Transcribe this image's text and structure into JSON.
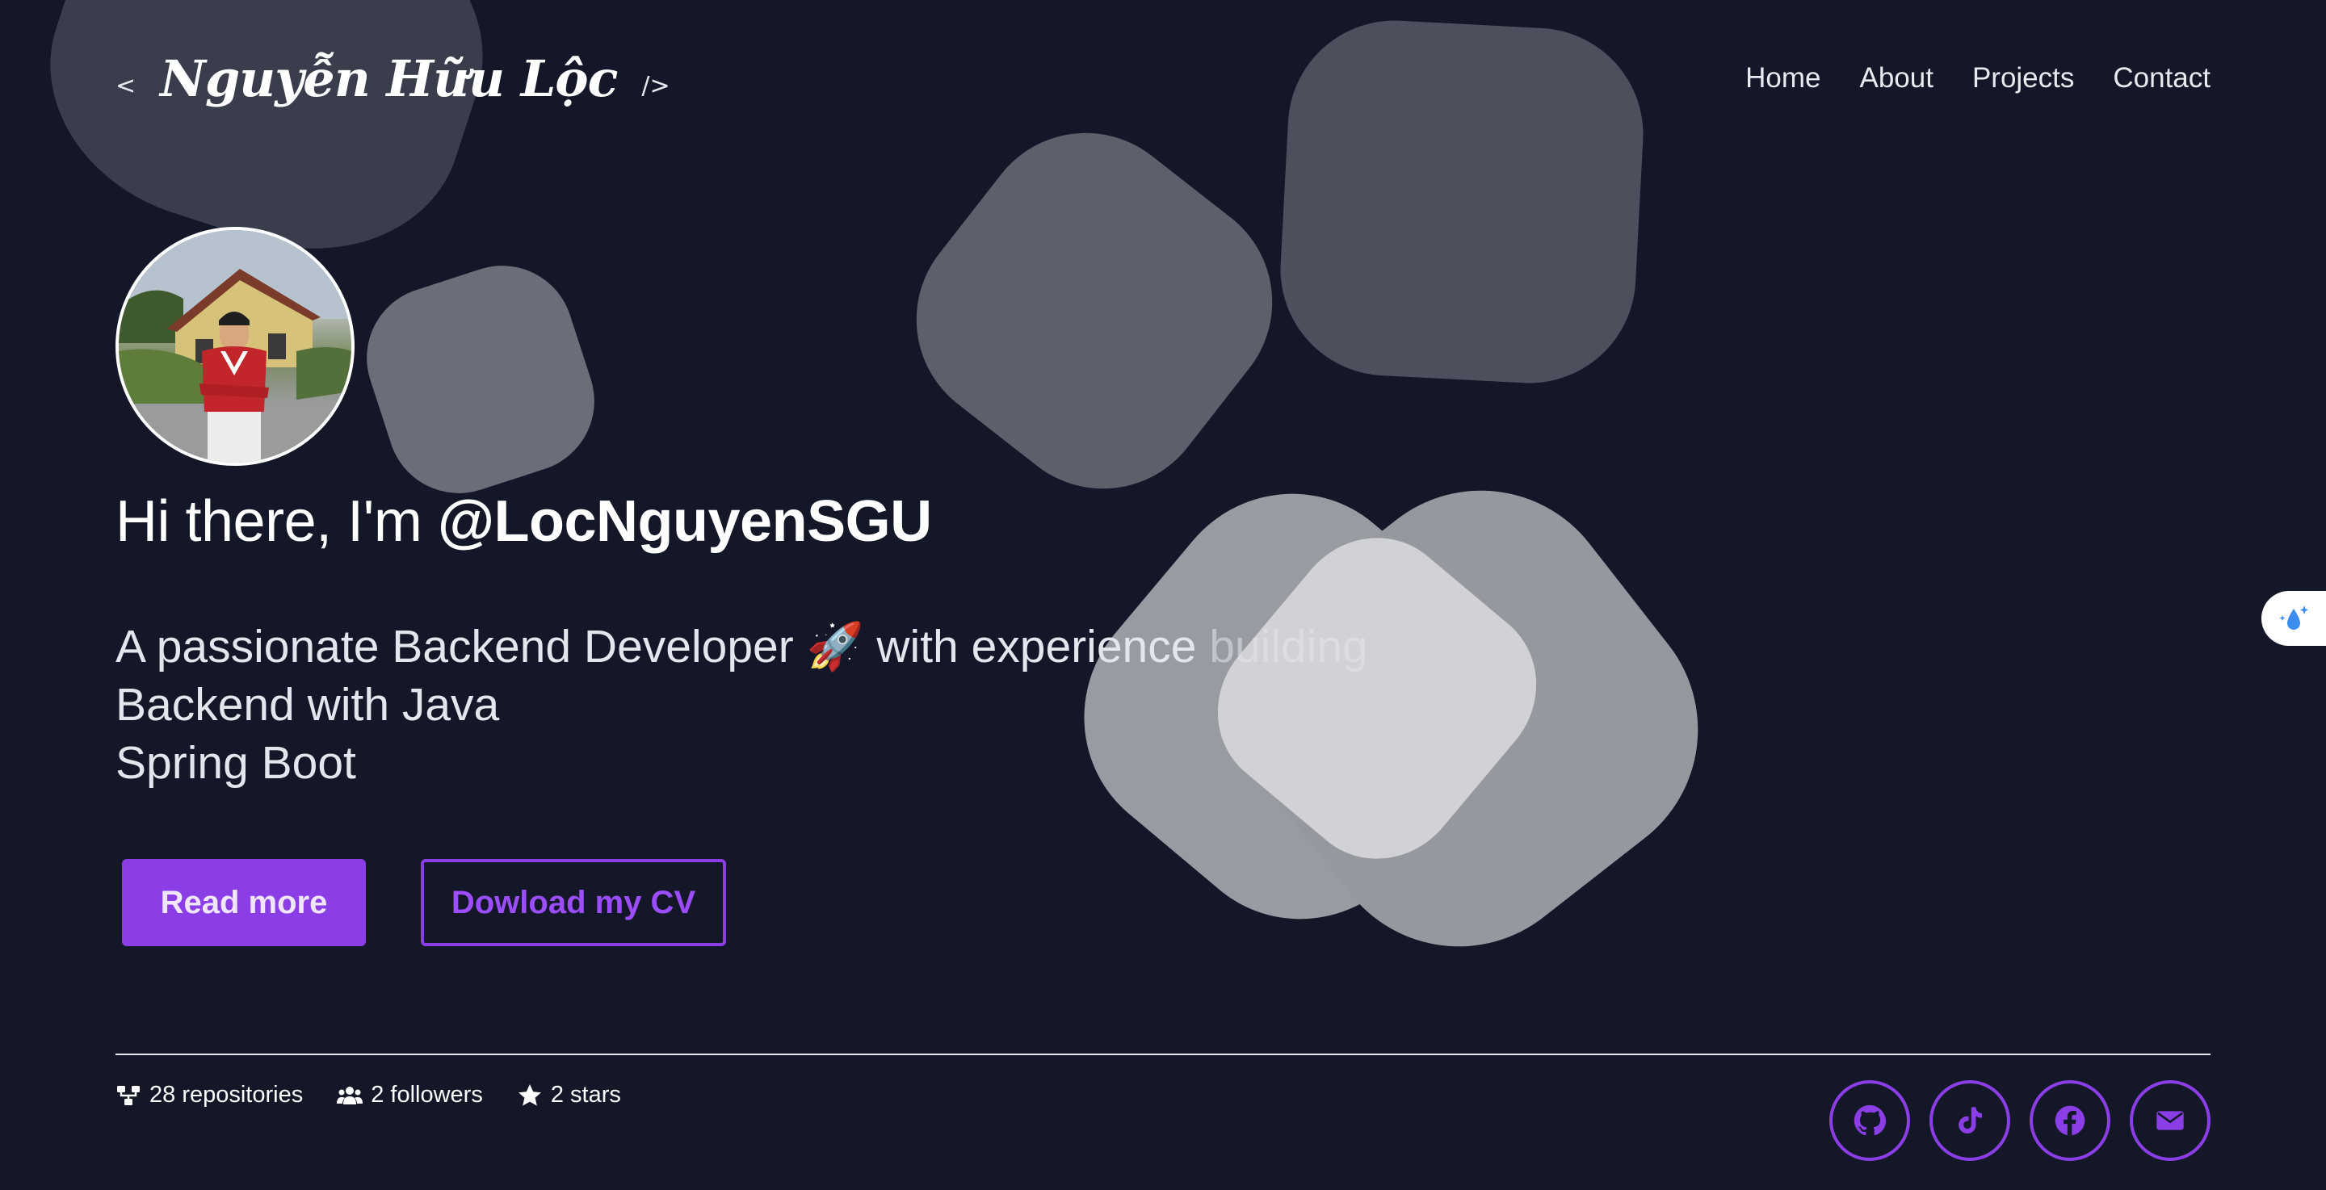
{
  "header": {
    "brand": {
      "open_bracket": "<",
      "name": "Nguyễn Hữu Lộc",
      "close_bracket": "/>"
    },
    "nav": [
      {
        "label": "Home"
      },
      {
        "label": "About"
      },
      {
        "label": "Projects"
      },
      {
        "label": "Contact"
      }
    ]
  },
  "hero": {
    "avatar_icon": "profile-photo",
    "greeting_prefix": "Hi there, I'm ",
    "greeting_handle": "@LocNguyenSGU",
    "tagline": {
      "line1_start": "A passionate Backend Developer 🚀 with experience ",
      "line1_fade": "building",
      "line2": "Backend with Java",
      "line3": "Spring Boot"
    },
    "buttons": {
      "primary": "Read more",
      "secondary": "Dowload my CV"
    }
  },
  "footer": {
    "stats": [
      {
        "icon": "repository-icon",
        "label": "28 repositories"
      },
      {
        "icon": "followers-icon",
        "label": "2 followers"
      },
      {
        "icon": "star-icon",
        "label": "2 stars"
      }
    ],
    "socials": [
      {
        "icon": "github-icon"
      },
      {
        "icon": "tiktok-icon"
      },
      {
        "icon": "facebook-icon"
      },
      {
        "icon": "mail-icon"
      }
    ]
  },
  "colors": {
    "background": "#131727",
    "accent": "#8b3ee6",
    "accent_text": "#9b4dff",
    "text": "#ffffff"
  },
  "side_widget": {
    "icon": "droplet-sparkle-icon"
  }
}
